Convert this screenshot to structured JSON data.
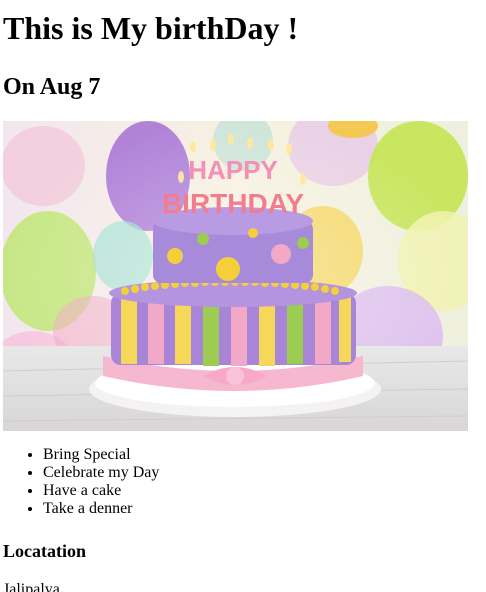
{
  "page": {
    "title": "This is My birthDay !",
    "date": "On Aug 7",
    "image": {
      "cake_topper_text_top": "HAPPY",
      "cake_topper_text_bottom": "BIRTHDAY"
    },
    "list": [
      {
        "label": "Bring Special"
      },
      {
        "label": "Celebrate my Day"
      },
      {
        "label": "Have a cake"
      },
      {
        "label": "Take a denner"
      }
    ],
    "location_heading": "Locatation",
    "location_value": "Jalipalya"
  }
}
